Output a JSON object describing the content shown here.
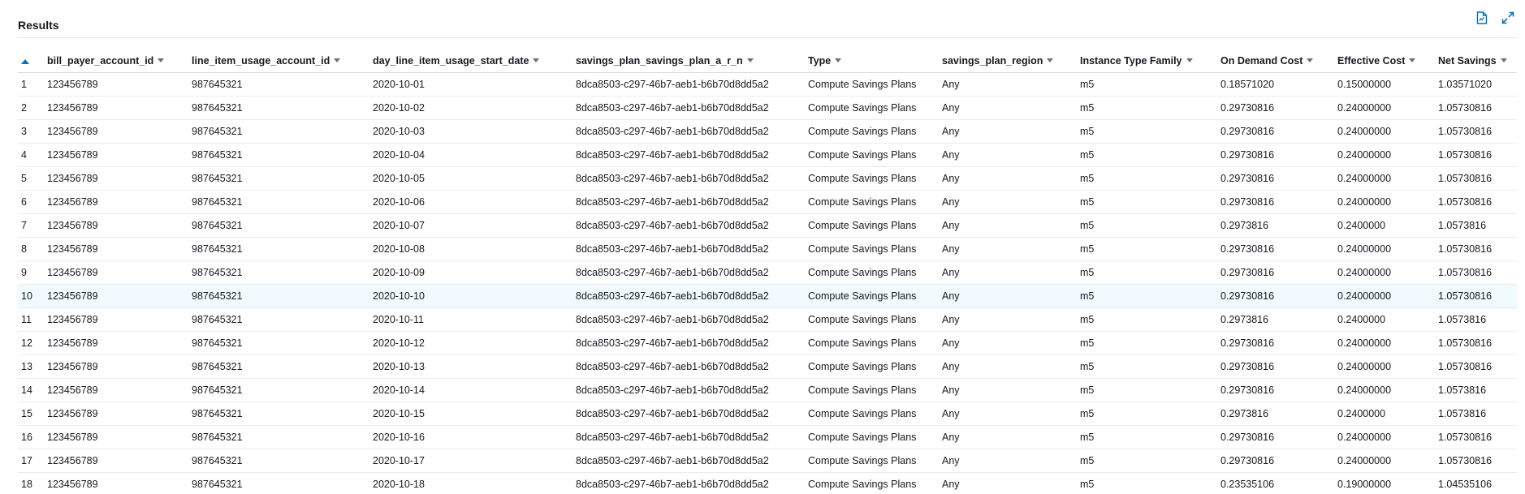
{
  "panel": {
    "title": "Results",
    "export_icon": "export-document-icon",
    "expand_icon": "expand-icon",
    "accent_color": "#0073bb"
  },
  "table": {
    "index_sort_icon": "sort-ascending-icon",
    "columns": [
      "bill_payer_account_id",
      "line_item_usage_account_id",
      "day_line_item_usage_start_date",
      "savings_plan_savings_plan_a_r_n",
      "Type",
      "savings_plan_region",
      "Instance Type Family",
      "On Demand Cost",
      "Effective Cost",
      "Net Savings"
    ],
    "selected_row": 10,
    "rows": [
      [
        "1",
        "123456789",
        "987645321",
        "2020-10-01",
        "8dca8503-c297-46b7-aeb1-b6b70d8dd5a2",
        "Compute Savings Plans",
        "Any",
        "m5",
        "0.18571020",
        "0.15000000",
        "1.03571020"
      ],
      [
        "2",
        "123456789",
        "987645321",
        "2020-10-02",
        "8dca8503-c297-46b7-aeb1-b6b70d8dd5a2",
        "Compute Savings Plans",
        "Any",
        "m5",
        "0.29730816",
        "0.24000000",
        "1.05730816"
      ],
      [
        "3",
        "123456789",
        "987645321",
        "2020-10-03",
        "8dca8503-c297-46b7-aeb1-b6b70d8dd5a2",
        "Compute Savings Plans",
        "Any",
        "m5",
        "0.29730816",
        "0.24000000",
        "1.05730816"
      ],
      [
        "4",
        "123456789",
        "987645321",
        "2020-10-04",
        "8dca8503-c297-46b7-aeb1-b6b70d8dd5a2",
        "Compute Savings Plans",
        "Any",
        "m5",
        "0.29730816",
        "0.24000000",
        "1.05730816"
      ],
      [
        "5",
        "123456789",
        "987645321",
        "2020-10-05",
        "8dca8503-c297-46b7-aeb1-b6b70d8dd5a2",
        "Compute Savings Plans",
        "Any",
        "m5",
        "0.29730816",
        "0.24000000",
        "1.05730816"
      ],
      [
        "6",
        "123456789",
        "987645321",
        "2020-10-06",
        "8dca8503-c297-46b7-aeb1-b6b70d8dd5a2",
        "Compute Savings Plans",
        "Any",
        "m5",
        "0.29730816",
        "0.24000000",
        "1.05730816"
      ],
      [
        "7",
        "123456789",
        "987645321",
        "2020-10-07",
        "8dca8503-c297-46b7-aeb1-b6b70d8dd5a2",
        "Compute Savings Plans",
        "Any",
        "m5",
        "0.2973816",
        "0.2400000",
        "1.0573816"
      ],
      [
        "8",
        "123456789",
        "987645321",
        "2020-10-08",
        "8dca8503-c297-46b7-aeb1-b6b70d8dd5a2",
        "Compute Savings Plans",
        "Any",
        "m5",
        "0.29730816",
        "0.24000000",
        "1.05730816"
      ],
      [
        "9",
        "123456789",
        "987645321",
        "2020-10-09",
        "8dca8503-c297-46b7-aeb1-b6b70d8dd5a2",
        "Compute Savings Plans",
        "Any",
        "m5",
        "0.29730816",
        "0.24000000",
        "1.05730816"
      ],
      [
        "10",
        "123456789",
        "987645321",
        "2020-10-10",
        "8dca8503-c297-46b7-aeb1-b6b70d8dd5a2",
        "Compute Savings Plans",
        "Any",
        "m5",
        "0.29730816",
        "0.24000000",
        "1.05730816"
      ],
      [
        "11",
        "123456789",
        "987645321",
        "2020-10-11",
        "8dca8503-c297-46b7-aeb1-b6b70d8dd5a2",
        "Compute Savings Plans",
        "Any",
        "m5",
        "0.2973816",
        "0.2400000",
        "1.0573816"
      ],
      [
        "12",
        "123456789",
        "987645321",
        "2020-10-12",
        "8dca8503-c297-46b7-aeb1-b6b70d8dd5a2",
        "Compute Savings Plans",
        "Any",
        "m5",
        "0.29730816",
        "0.24000000",
        "1.05730816"
      ],
      [
        "13",
        "123456789",
        "987645321",
        "2020-10-13",
        "8dca8503-c297-46b7-aeb1-b6b70d8dd5a2",
        "Compute Savings Plans",
        "Any",
        "m5",
        "0.29730816",
        "0.24000000",
        "1.05730816"
      ],
      [
        "14",
        "123456789",
        "987645321",
        "2020-10-14",
        "8dca8503-c297-46b7-aeb1-b6b70d8dd5a2",
        "Compute Savings Plans",
        "Any",
        "m5",
        "0.29730816",
        "0.24000000",
        "1.0573816"
      ],
      [
        "15",
        "123456789",
        "987645321",
        "2020-10-15",
        "8dca8503-c297-46b7-aeb1-b6b70d8dd5a2",
        "Compute Savings Plans",
        "Any",
        "m5",
        "0.2973816",
        "0.2400000",
        "1.0573816"
      ],
      [
        "16",
        "123456789",
        "987645321",
        "2020-10-16",
        "8dca8503-c297-46b7-aeb1-b6b70d8dd5a2",
        "Compute Savings Plans",
        "Any",
        "m5",
        "0.29730816",
        "0.24000000",
        "1.05730816"
      ],
      [
        "17",
        "123456789",
        "987645321",
        "2020-10-17",
        "8dca8503-c297-46b7-aeb1-b6b70d8dd5a2",
        "Compute Savings Plans",
        "Any",
        "m5",
        "0.29730816",
        "0.24000000",
        "1.05730816"
      ],
      [
        "18",
        "123456789",
        "987645321",
        "2020-10-18",
        "8dca8503-c297-46b7-aeb1-b6b70d8dd5a2",
        "Compute Savings Plans",
        "Any",
        "m5",
        "0.23535106",
        "0.19000000",
        "1.04535106"
      ]
    ]
  }
}
